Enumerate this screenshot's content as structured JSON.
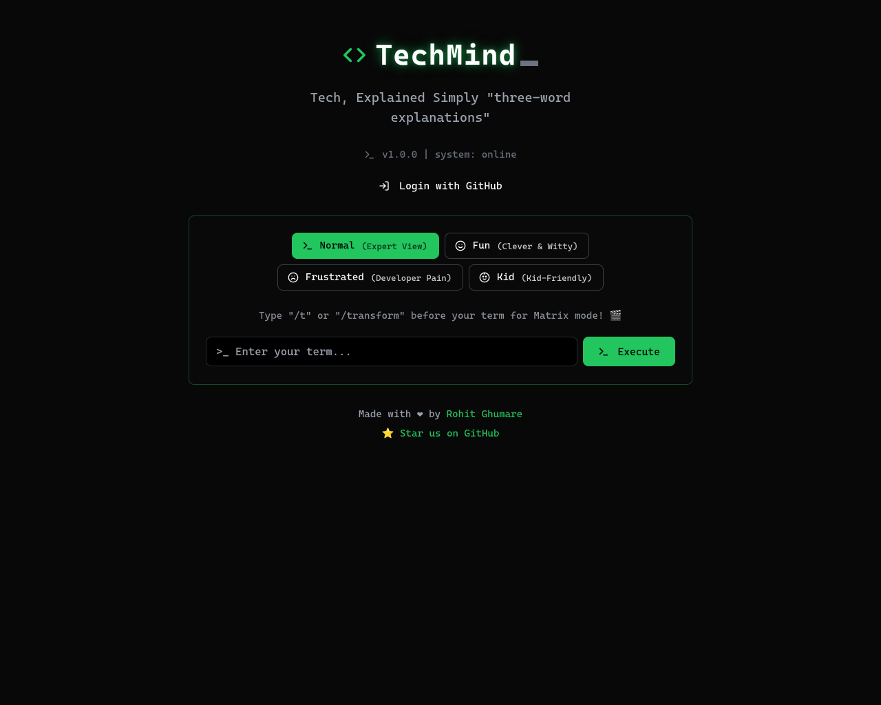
{
  "header": {
    "title": "TechMind",
    "tagline": "Tech, Explained Simply \"three-word explanations\"",
    "sysline": "v1.0.0 | system: online",
    "login_label": "Login with GitHub"
  },
  "modes": [
    {
      "id": "normal",
      "label": "Normal",
      "sub": "(Expert View)",
      "active": true,
      "icon": "terminal"
    },
    {
      "id": "fun",
      "label": "Fun",
      "sub": "(Clever & Witty)",
      "active": false,
      "icon": "smile"
    },
    {
      "id": "frustrated",
      "label": "Frustrated",
      "sub": "(Developer Pain)",
      "active": false,
      "icon": "frown"
    },
    {
      "id": "kid",
      "label": "Kid",
      "sub": "(Kid-Friendly)",
      "active": false,
      "icon": "baby"
    }
  ],
  "panel": {
    "hint": "Type \"/t\" or \"/transform\" before your term for Matrix mode! 🎬",
    "input_placeholder": ">_ Enter your term...",
    "input_value": "",
    "execute_label": "Execute"
  },
  "footer": {
    "prefix": "Made with ❤ by ",
    "author": "Rohit Ghumare",
    "star_text": "⭐ Star us on GitHub"
  }
}
